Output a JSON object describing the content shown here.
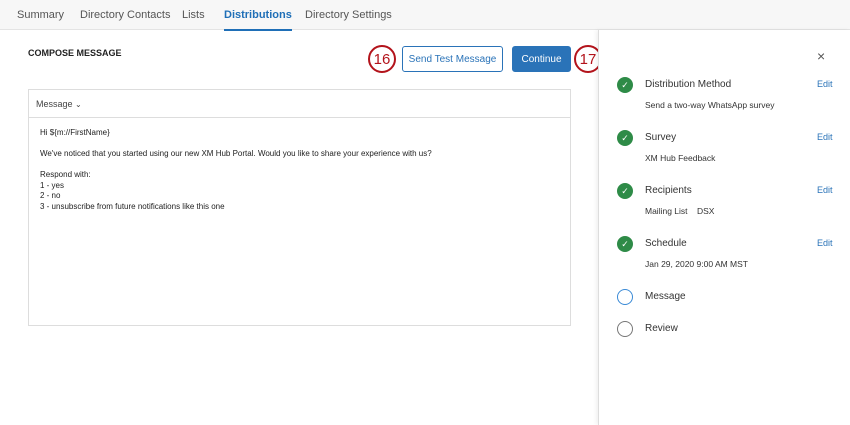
{
  "tabs": [
    "Summary",
    "Directory Contacts",
    "Lists",
    "Distributions",
    "Directory Settings"
  ],
  "compose": {
    "title": "COMPOSE MESSAGE",
    "send_test": "Send Test Message",
    "continue": "Continue",
    "badge_send": "16",
    "badge_continue": "17"
  },
  "editor": {
    "dropdown": "Message",
    "body": "Hi ${m://FirstName}\n\nWe've noticed that you started using our new XM Hub Portal. Would you like to share your experience with us?\n\nRespond with:\n1 - yes\n2 - no\n3 - unsubscribe from future notifications like this one"
  },
  "panel": {
    "close": "×",
    "edit": "Edit",
    "steps": [
      {
        "title": "Distribution Method",
        "desc": "Send a two-way WhatsApp survey",
        "status": "done"
      },
      {
        "title": "Survey",
        "desc": "XM Hub Feedback",
        "status": "done"
      },
      {
        "title": "Recipients",
        "desc": "Mailing List    DSX",
        "status": "done"
      },
      {
        "title": "Schedule",
        "desc": "Jan 29, 2020 9:00 AM MST",
        "status": "done"
      },
      {
        "title": "Message",
        "status": "current"
      },
      {
        "title": "Review",
        "status": "todo"
      }
    ]
  }
}
